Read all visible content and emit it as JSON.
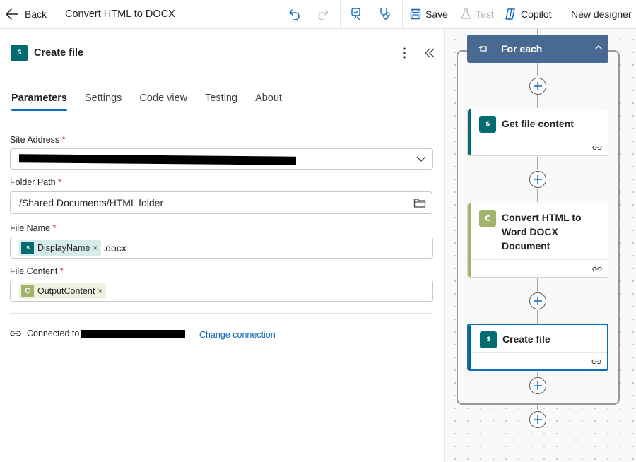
{
  "topbar": {
    "back_label": "Back",
    "flow_title": "Convert HTML to DOCX",
    "save_label": "Save",
    "test_label": "Test",
    "copilot_label": "Copilot",
    "new_designer_label": "New designer"
  },
  "panel": {
    "title": "Create file",
    "tabs": [
      {
        "label": "Parameters",
        "active": true
      },
      {
        "label": "Settings",
        "active": false
      },
      {
        "label": "Code view",
        "active": false
      },
      {
        "label": "Testing",
        "active": false
      },
      {
        "label": "About",
        "active": false
      }
    ],
    "fields": {
      "site_address": {
        "label": "Site Address",
        "required_mark": "*"
      },
      "folder_path": {
        "label": "Folder Path",
        "required_mark": "*",
        "value": "/Shared Documents/HTML folder"
      },
      "file_name": {
        "label": "File Name",
        "required_mark": "*",
        "token": "DisplayName",
        "suffix": ".docx"
      },
      "file_content": {
        "label": "File Content",
        "required_mark": "*",
        "token": "OutputContent"
      }
    },
    "connection": {
      "prefix": "Connected to",
      "change_label": "Change connection"
    }
  },
  "canvas": {
    "foreach_label": "For each",
    "cards": [
      {
        "title": "Get file content",
        "icon": "sharepoint-icon"
      },
      {
        "title_lines": [
          "Convert HTML to",
          "Word DOCX",
          "Document"
        ],
        "icon": "convert-connector-icon"
      },
      {
        "title": "Create file",
        "icon": "sharepoint-icon",
        "selected": true
      }
    ]
  },
  "colors": {
    "accent": "#0f6cbd",
    "sharepoint": "#036c70",
    "foreach_header": "#486991",
    "converter": "#a2b36b",
    "required": "#c4314b"
  }
}
